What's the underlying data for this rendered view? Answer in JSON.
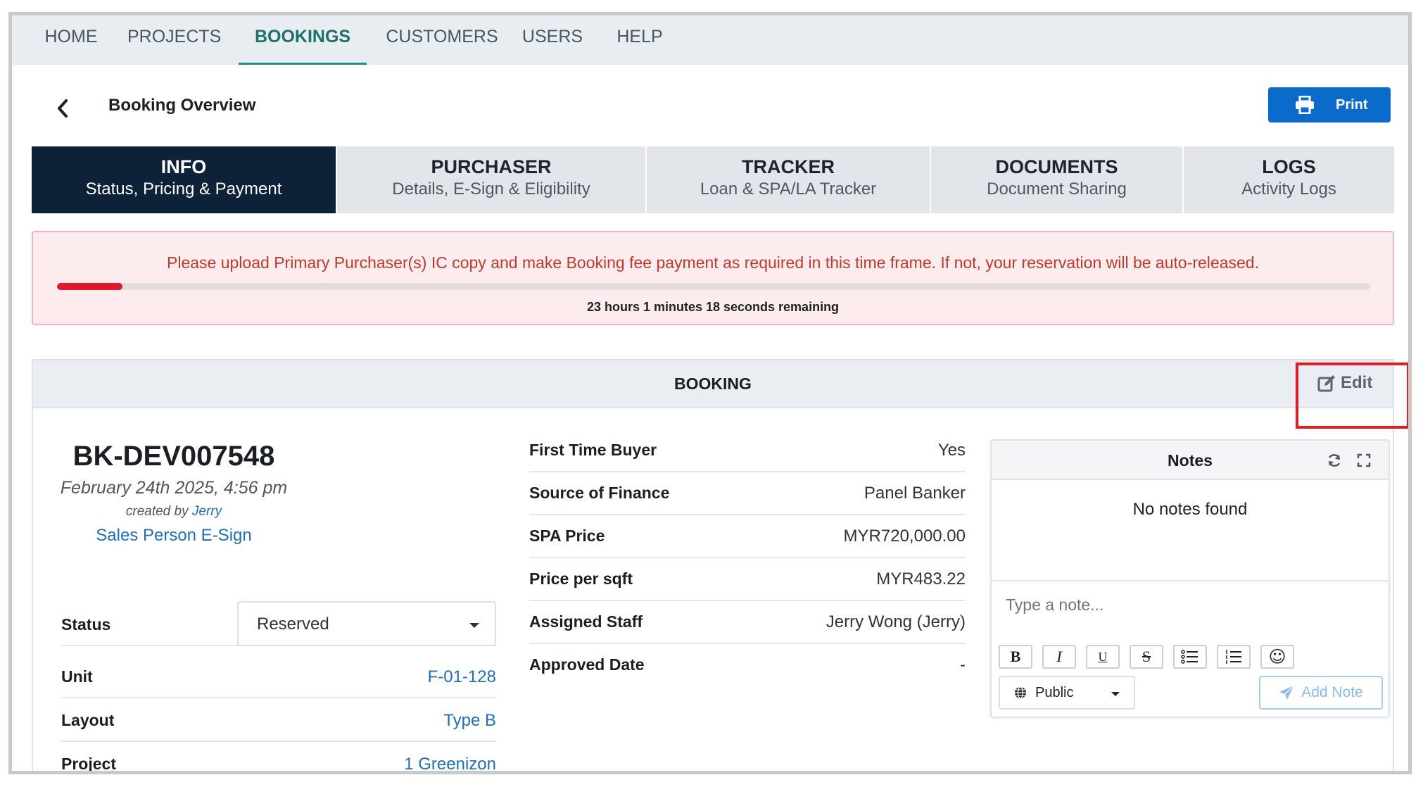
{
  "nav": {
    "items": [
      {
        "label": "HOME",
        "active": false
      },
      {
        "label": "PROJECTS",
        "active": false
      },
      {
        "label": "BOOKINGS",
        "active": true
      },
      {
        "label": "CUSTOMERS",
        "active": false
      },
      {
        "label": "USERS",
        "active": false
      },
      {
        "label": "HELP",
        "active": false
      }
    ]
  },
  "header": {
    "back_icon": "chevron-left-icon",
    "title": "Booking Overview",
    "print_label": "Print",
    "print_icon": "printer-icon"
  },
  "tabs": [
    {
      "title": "INFO",
      "subtitle": "Status, Pricing & Payment",
      "active": true
    },
    {
      "title": "PURCHASER",
      "subtitle": "Details, E-Sign & Eligibility",
      "active": false
    },
    {
      "title": "TRACKER",
      "subtitle": "Loan & SPA/LA Tracker",
      "active": false
    },
    {
      "title": "DOCUMENTS",
      "subtitle": "Document Sharing",
      "active": false
    },
    {
      "title": "LOGS",
      "subtitle": "Activity Logs",
      "active": false
    }
  ],
  "alert": {
    "message": "Please upload Primary Purchaser(s) IC copy and make Booking fee payment as required in this time frame. If not, your reservation will be auto-released.",
    "progress_percent": 5,
    "countdown": "23 hours 1 minutes 18 seconds remaining"
  },
  "booking": {
    "section_title": "BOOKING",
    "edit_label": "Edit",
    "edit_icon": "edit-icon",
    "id": "BK-DEV007548",
    "date": "February 24th 2025, 4:56 pm",
    "created_by_prefix": "created by",
    "created_by_name": "Jerry",
    "sales_esign_link": "Sales Person E-Sign",
    "status_label": "Status",
    "status_value": "Reserved",
    "details": [
      {
        "label": "Unit",
        "value": "F-01-128"
      },
      {
        "label": "Layout",
        "value": "Type B"
      },
      {
        "label": "Project",
        "value": "1 Greenizon"
      }
    ],
    "info": [
      {
        "label": "First Time Buyer",
        "value": "Yes"
      },
      {
        "label": "Source of Finance",
        "value": "Panel Banker"
      },
      {
        "label": "SPA Price",
        "value": "MYR720,000.00"
      },
      {
        "label": "Price per sqft",
        "value": "MYR483.22"
      },
      {
        "label": "Assigned Staff",
        "value": "Jerry Wong (Jerry)"
      },
      {
        "label": "Approved Date",
        "value": "-"
      }
    ]
  },
  "notes": {
    "title": "Notes",
    "empty_text": "No notes found",
    "placeholder": "Type a note...",
    "toolbar": [
      {
        "name": "bold-icon",
        "glyph": "B"
      },
      {
        "name": "italic-icon",
        "glyph": "I"
      },
      {
        "name": "underline-icon",
        "glyph": "U"
      },
      {
        "name": "strikethrough-icon",
        "glyph": "S"
      },
      {
        "name": "bullet-list-icon",
        "glyph": "☰"
      },
      {
        "name": "numbered-list-icon",
        "glyph": "☰"
      },
      {
        "name": "emoji-icon",
        "glyph": "☺"
      }
    ],
    "visibility": "Public",
    "add_label": "Add Note"
  },
  "colors": {
    "accent": "#0b6bcb",
    "active_tab": "#0d2238",
    "alert_text": "#c0392b",
    "alert_bar": "#e0162b",
    "link": "#1f6fb8",
    "highlight": "#e31b23"
  }
}
